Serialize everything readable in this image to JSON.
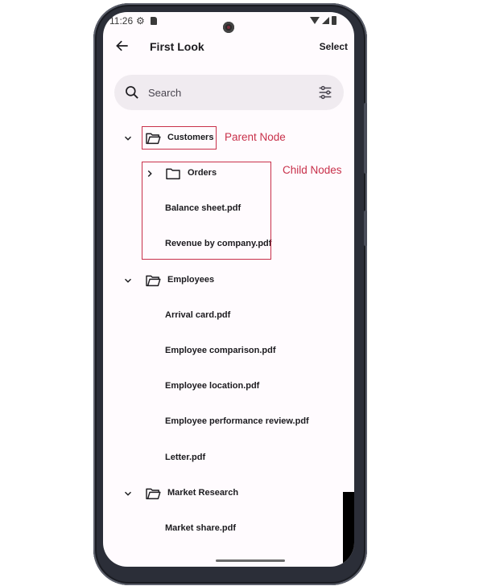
{
  "status_bar": {
    "time": "11:26",
    "left_icons": [
      "settings-icon",
      "sd-card-icon"
    ],
    "right_icons": [
      "wifi-icon",
      "cell-signal-icon",
      "battery-icon"
    ]
  },
  "app_bar": {
    "back_icon": "arrow-back-icon",
    "title": "First Look",
    "action_label": "Select"
  },
  "search": {
    "placeholder": "Search",
    "value": "",
    "leading_icon": "search-icon",
    "trailing_icon": "filter-sliders-icon"
  },
  "tree": {
    "nodes": [
      {
        "label": "Customers",
        "level": 0,
        "type": "folder",
        "expanded": true
      },
      {
        "label": "Orders",
        "level": 1,
        "type": "folder",
        "expanded": false
      },
      {
        "label": "Balance sheet.pdf",
        "level": 1,
        "type": "file"
      },
      {
        "label": "Revenue by company.pdf",
        "level": 1,
        "type": "file"
      },
      {
        "label": "Employees",
        "level": 0,
        "type": "folder",
        "expanded": true
      },
      {
        "label": "Arrival card.pdf",
        "level": 1,
        "type": "file"
      },
      {
        "label": "Employee comparison.pdf",
        "level": 1,
        "type": "file"
      },
      {
        "label": "Employee location.pdf",
        "level": 1,
        "type": "file"
      },
      {
        "label": "Employee performance review.pdf",
        "level": 1,
        "type": "file"
      },
      {
        "label": "Letter.pdf",
        "level": 1,
        "type": "file"
      },
      {
        "label": "Market Research",
        "level": 0,
        "type": "folder",
        "expanded": true
      },
      {
        "label": "Market share.pdf",
        "level": 1,
        "type": "file"
      }
    ]
  },
  "annotations": {
    "parent": "Parent Node",
    "children": "Child Nodes",
    "color": "#c8304a"
  }
}
